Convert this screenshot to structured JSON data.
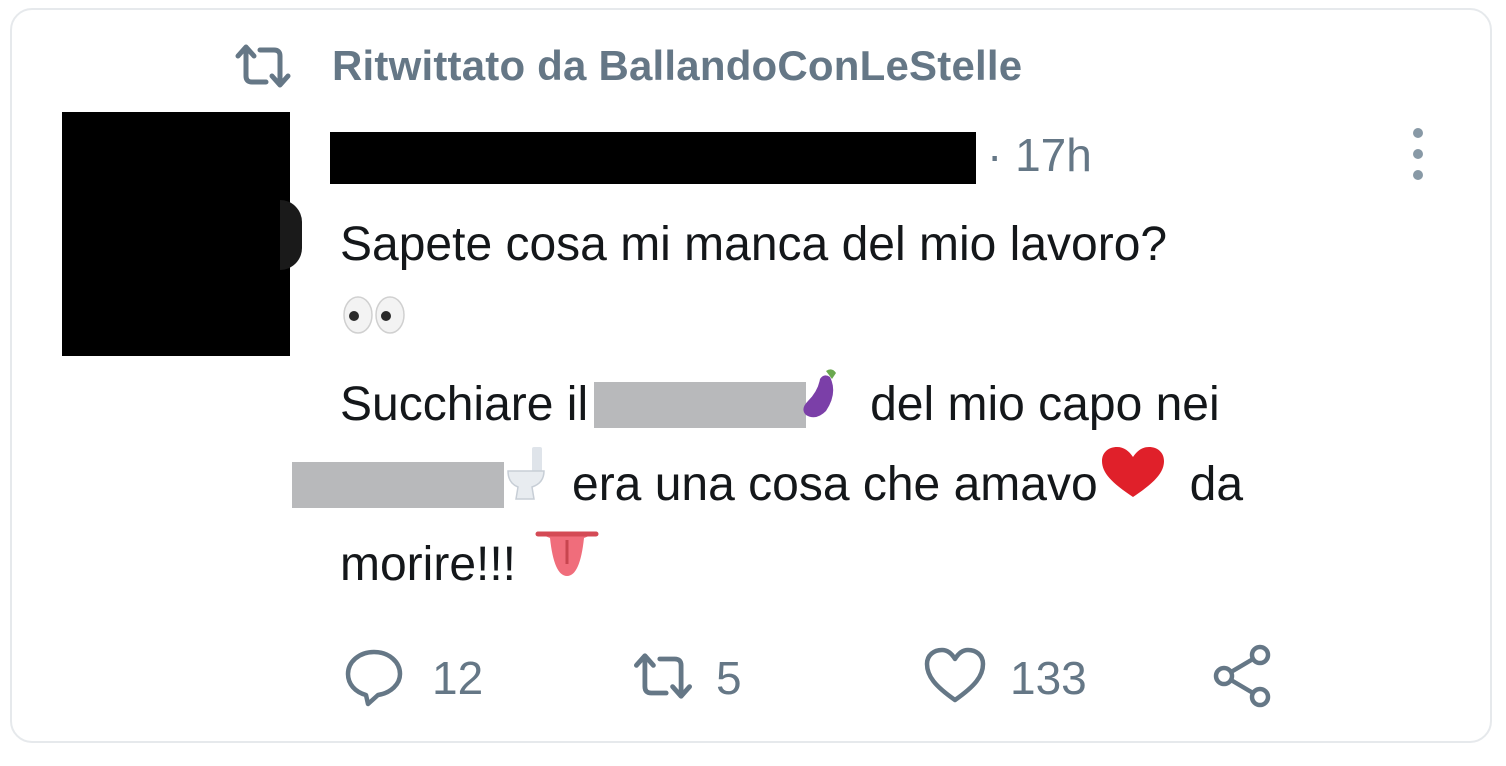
{
  "retweet_banner": {
    "label": "Ritwittato da BallandoConLeStelle",
    "icon": "retweet-icon"
  },
  "tweet": {
    "timestamp": "· 17h",
    "more_icon": "more-vertical-icon",
    "lines": {
      "l1": "Sapete cosa mi manca del mio lavoro?",
      "l3_start": "Succhiare il",
      "l3_end": "del mio capo nei",
      "l4_mid": "era una cosa che amavo",
      "l4_end": "da",
      "l5": "morire!!!"
    },
    "emojis": [
      "eyes-emoji",
      "eggplant-emoji",
      "toilet-emoji",
      "red-heart-emoji",
      "tongue-emoji"
    ]
  },
  "actions": {
    "reply_count": "12",
    "retweet_count": "5",
    "like_count": "133"
  },
  "colors": {
    "muted": "#657786",
    "text": "#14171a",
    "border": "#e6e9ec",
    "redaction": "#000000",
    "blur_box": "#b8b9bb"
  }
}
